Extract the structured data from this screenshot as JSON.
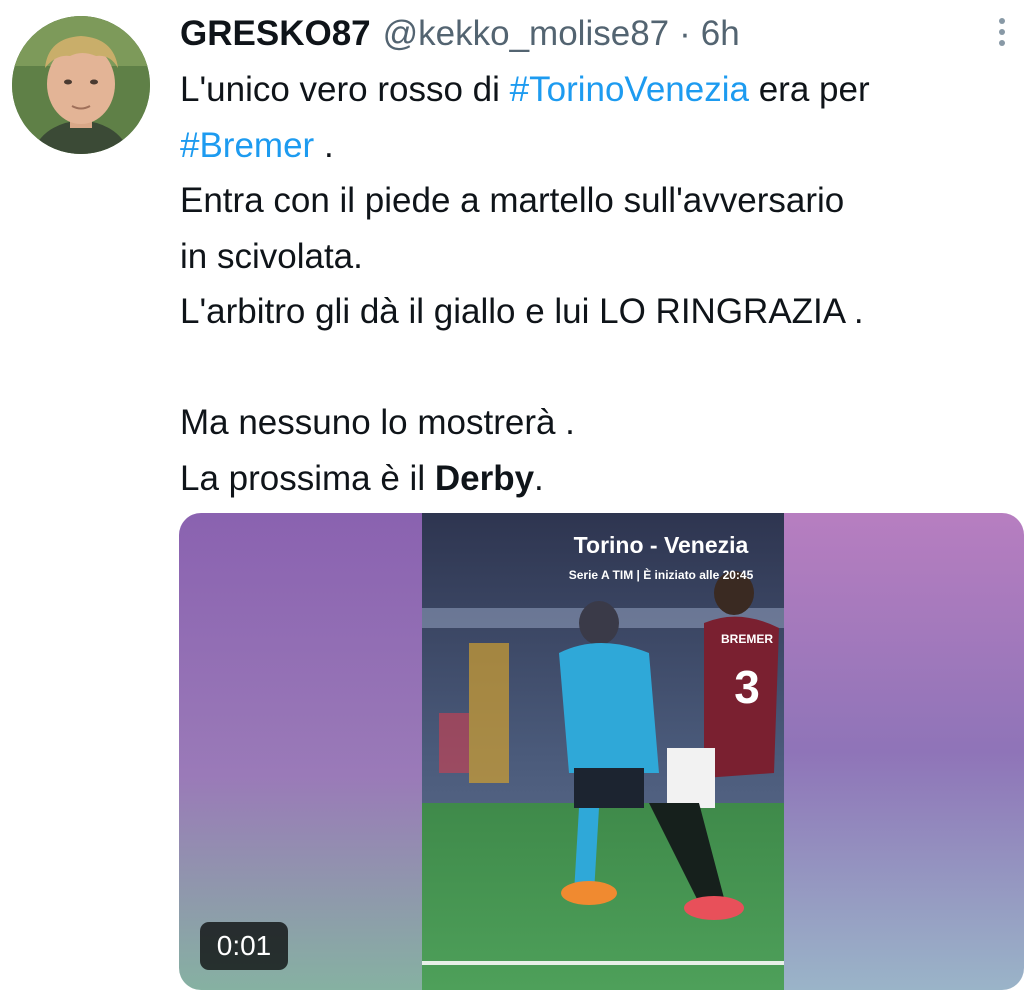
{
  "tweet": {
    "author": {
      "display_name": "GRESKO87",
      "handle": "@kekko_molise87",
      "separator": "·",
      "time": "6h"
    },
    "lines": {
      "l1_before": "L'unico vero rosso di ",
      "l1_hashtag": "#TorinoVenezia",
      "l1_after": " era per",
      "l2_hashtag": "#Bremer",
      "l2_after": " .",
      "l3": "Entra con il piede a martello sull'avversario",
      "l4": "in scivolata.",
      "l5": "L'arbitro gli dà il giallo e lui LO RINGRAZIA .",
      "l6": "Ma nessuno lo mostrerà .",
      "l7_before": "La prossima è il ",
      "l7_bold": "Derby",
      "l7_after": "."
    },
    "media": {
      "overlay_title": "Torino - Venezia",
      "overlay_subtitle": "Serie A TIM | È iniziato alle 20:45",
      "jersey_number": "3",
      "jersey_name": "BREMER",
      "duration": "0:01"
    }
  },
  "icons": {
    "more": "vertical-dots-icon",
    "avatar": "profile-photo"
  },
  "colors": {
    "text": "#0f1419",
    "secondary": "#536471",
    "link": "#1d9bf0",
    "background": "#ffffff"
  }
}
